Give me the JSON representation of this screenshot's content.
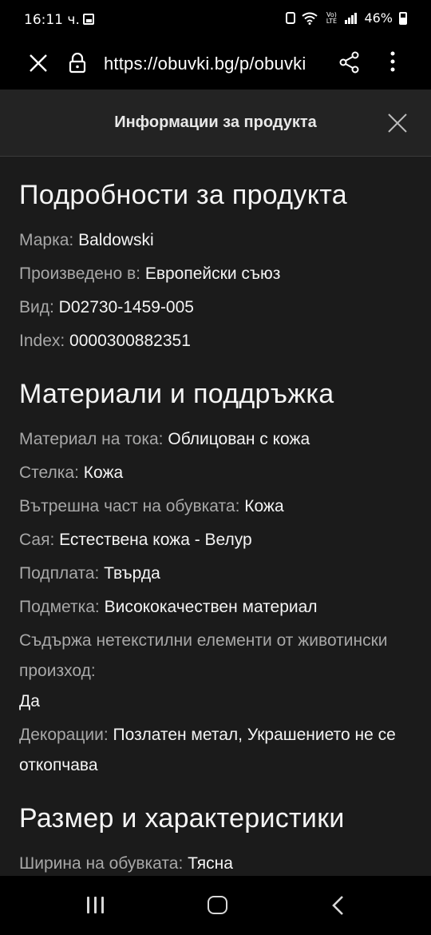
{
  "status_bar": {
    "time": "16:11 ч.",
    "battery": "46%",
    "network": "Vo) LTE"
  },
  "browser": {
    "url": "https://obuvki.bg/p/obuvki"
  },
  "sheet": {
    "title": "Информации за продукта"
  },
  "sections": {
    "details": {
      "title": "Подробности за продукта",
      "rows": [
        {
          "key": "Марка: ",
          "value": "Baldowski"
        },
        {
          "key": "Произведено в: ",
          "value": "Европейски съюз"
        },
        {
          "key": "Вид: ",
          "value": "D02730-1459-005"
        },
        {
          "key": "Index: ",
          "value": "0000300882351"
        }
      ]
    },
    "materials": {
      "title": "Материали и поддръжка",
      "rows": [
        {
          "key": "Материал на тока: ",
          "value": "Облицован с кожа"
        },
        {
          "key": "Стелка: ",
          "value": "Кожа"
        },
        {
          "key": "Вътрешна част на обувката: ",
          "value": "Кожа"
        },
        {
          "key": "Сая: ",
          "value": "Естествена кожа - Велур"
        },
        {
          "key": "Подплата: ",
          "value": "Твърда"
        },
        {
          "key": "Подметка: ",
          "value": "Висококачествен материал"
        },
        {
          "key": "Съдържа нетекстилни елементи от животински произход: ",
          "value": "Да"
        },
        {
          "key": "Декорации: ",
          "value": "Позлатен метал, Украшението не се откопчава"
        }
      ]
    },
    "size": {
      "title": "Размер и характеристики",
      "rows": [
        {
          "key": "Ширина на обувката: ",
          "value": "Тясна"
        }
      ]
    }
  },
  "colors": {
    "background": "#1b1b1b",
    "label": "#a8a8a8",
    "value": "#f4f4f4"
  }
}
